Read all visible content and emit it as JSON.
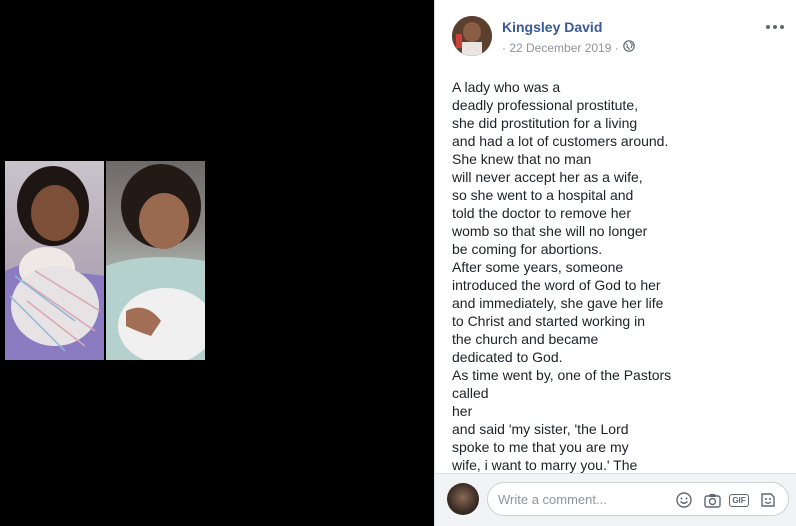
{
  "post": {
    "author": "Kingsley David",
    "date": "· 22 December 2019 ·",
    "privacy_icon": "globe-icon",
    "lines": [
      "A lady who was a",
      "deadly professional prostitute,",
      "she did prostitution for a living",
      "and had a lot of customers around.",
      "She knew that no man",
      "will never accept her as a wife,",
      "so she went to a hospital and",
      "told the doctor to remove her",
      "womb so that she will no longer",
      "be coming for abortions.",
      "After some years, someone",
      "introduced the word of God to her",
      "and immediately, she gave her life",
      "to Christ and started working in",
      "the church and became",
      "dedicated to God.",
      "As time went by, one of the Pastors",
      "called",
      "her",
      "and said 'my sister, 'the Lord",
      "spoke to me that you are my",
      "wife, i want to marry you.' The"
    ]
  },
  "comment": {
    "placeholder": "Write a comment...",
    "gif_label": "GIF"
  },
  "colors": {
    "author": "#385898",
    "meta": "#90949c",
    "text": "#1d2129"
  }
}
